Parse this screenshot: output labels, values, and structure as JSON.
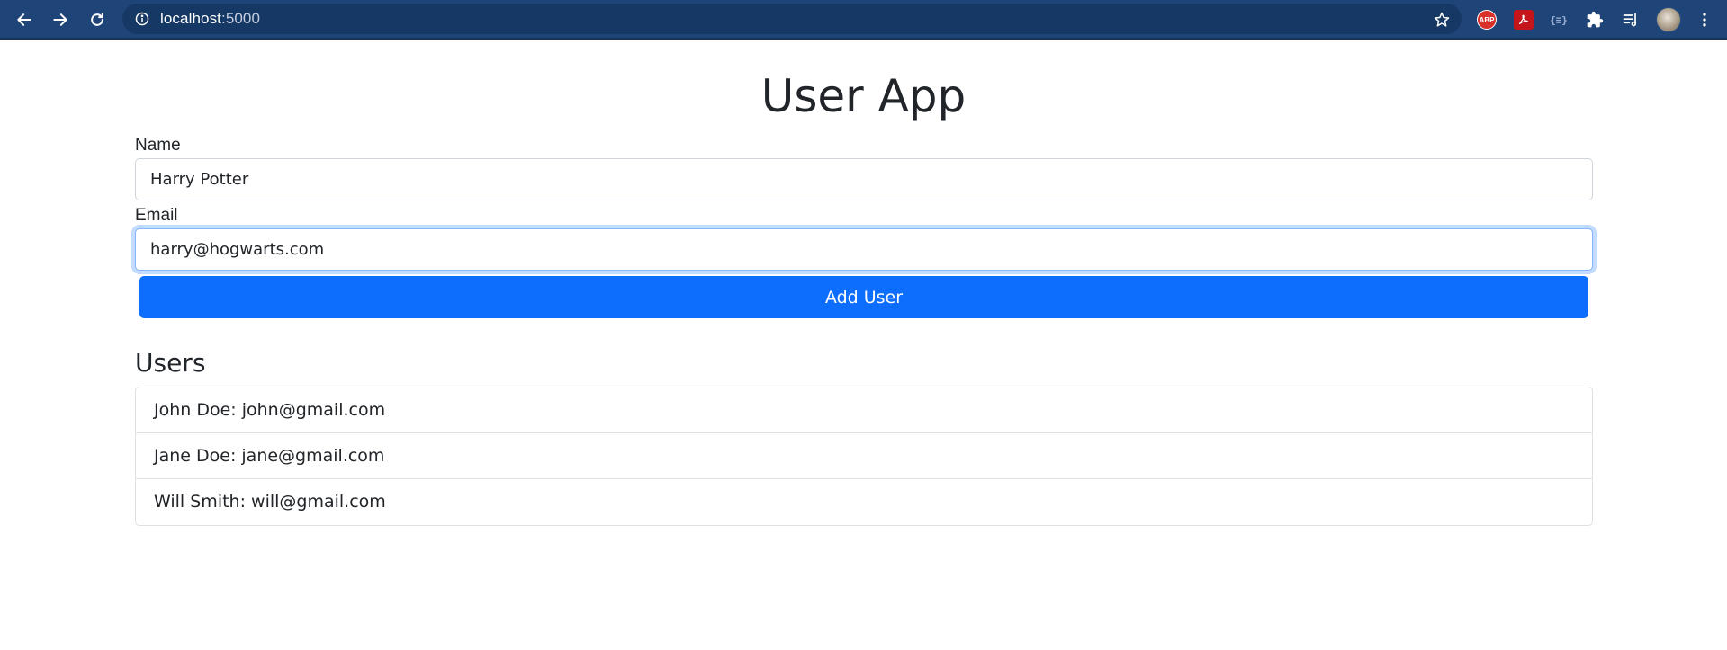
{
  "browser": {
    "url_host": "localhost",
    "url_port": ":5000",
    "extensions": {
      "abp_label": "ABP",
      "json_label": "{≡}"
    }
  },
  "app": {
    "title": "User App",
    "form": {
      "name_label": "Name",
      "name_value": "Harry Potter",
      "email_label": "Email",
      "email_value": "harry@hogwarts.com",
      "submit_label": "Add User"
    },
    "users_heading": "Users",
    "users": [
      {
        "text": "John Doe: john@gmail.com"
      },
      {
        "text": "Jane Doe: jane@gmail.com"
      },
      {
        "text": "Will Smith: will@gmail.com"
      }
    ]
  },
  "colors": {
    "browser_bar": "#1f4478",
    "primary": "#0d6efd",
    "text": "#212529",
    "border": "#dee2e6"
  }
}
